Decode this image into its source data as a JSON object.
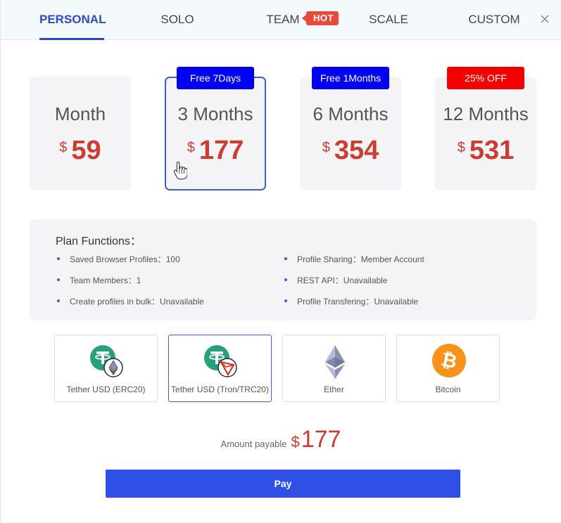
{
  "tabs": [
    {
      "label": "PERSONAL",
      "active": true
    },
    {
      "label": "SOLO",
      "active": false
    },
    {
      "label": "TEAM",
      "active": false,
      "badge": "HOT"
    },
    {
      "label": "SCALE",
      "active": false
    },
    {
      "label": "CUSTOM",
      "active": false
    }
  ],
  "close_label": "×",
  "plans": [
    {
      "name": "Month",
      "currency": "$",
      "price": "59",
      "badge": null,
      "selected": false
    },
    {
      "name": "3 Months",
      "currency": "$",
      "price": "177",
      "badge": "Free 7Days",
      "selected": true
    },
    {
      "name": "6 Months",
      "currency": "$",
      "price": "354",
      "badge": "Free 1Months",
      "selected": false
    },
    {
      "name": "12 Months",
      "currency": "$",
      "price": "531",
      "badge": "25% OFF",
      "selected": false
    }
  ],
  "functions": {
    "title": "Plan Functions：",
    "items": [
      "Saved Browser Profiles：100",
      "Team Members：1",
      "Create profiles in bulk：Unavailable",
      "Profile Sharing：Member Account",
      "REST API：Unavailable",
      "Profile Transfering：Unavailable"
    ]
  },
  "payment_methods": [
    {
      "label": "Tether USD (ERC20)",
      "icon": "tether-erc20-icon",
      "selected": false
    },
    {
      "label": "Tether USD (Tron/TRC20)",
      "icon": "tether-trc20-icon",
      "selected": true
    },
    {
      "label": "Ether",
      "icon": "ether-icon",
      "selected": false
    },
    {
      "label": "Bitcoin",
      "icon": "bitcoin-icon",
      "selected": false
    }
  ],
  "amount": {
    "label": "Amount payable",
    "currency": "$",
    "value": "177"
  },
  "pay_button": "Pay",
  "colors": {
    "accent": "#2f48c9",
    "price_red": "#cd3c30",
    "badge_blue": "#0000f5",
    "badge_red": "#f50000",
    "hot_red": "#e74a3b",
    "pay_button": "#2f4fe6",
    "tether_green": "#26a17b",
    "bitcoin_orange": "#f7931a"
  }
}
